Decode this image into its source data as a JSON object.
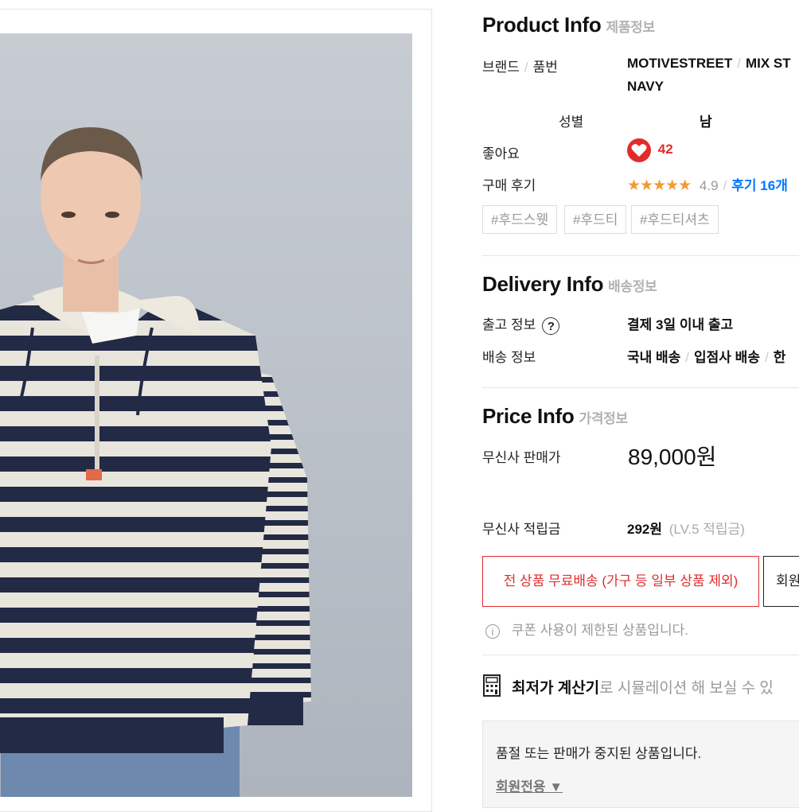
{
  "product_info": {
    "title": "Product Info",
    "subtitle": "제품정보",
    "brand_label": "브랜드",
    "number_label": "품번",
    "brand": "MOTIVESTREET",
    "product_number": "MIX ST",
    "product_number_line2": "NAVY",
    "gender_label": "성별",
    "gender": "남",
    "likes_label": "좋아요",
    "likes_count": "42",
    "review_label": "구매 후기",
    "rating_stars": "★★★★★",
    "rating": "4.9",
    "review_count": "후기 16개",
    "tags": [
      "#후드스웻",
      "#후드티",
      "#후드티셔츠"
    ]
  },
  "delivery_info": {
    "title": "Delivery Info",
    "subtitle": "배송정보",
    "release_label": "출고 정보",
    "release_value": "결제 3일 이내 출고",
    "shipping_label": "배송 정보",
    "shipping_domestic": "국내 배송",
    "shipping_vendor": "입점사 배송",
    "shipping_more": "한"
  },
  "price_info": {
    "title": "Price Info",
    "subtitle": "가격정보",
    "price_label": "무신사 판매가",
    "price": "89,000원",
    "points_label": "무신사 적립금",
    "points": "292원",
    "points_note": "(LV.5 적립금)",
    "free_shipping_button": "전 상품 무료배송 (가구 등 일부 상품 제외)",
    "member_button": "회원",
    "coupon_notice": "쿠폰 사용이 제한된 상품입니다.",
    "calculator_bold": "최저가 계산기",
    "calculator_rest": "로 시뮬레이션 해 보실 수 있",
    "sold_out_notice": "품절 또는 판매가 중지된 상품입니다.",
    "members_only": "회원전용 ▼"
  },
  "colors": {
    "accent_red": "#e22c2c",
    "link_blue": "#0078ff",
    "star_orange": "#f29b33"
  },
  "icons": [
    "question-circle-icon",
    "heart-icon",
    "star-icon",
    "info-icon",
    "calculator-icon"
  ]
}
